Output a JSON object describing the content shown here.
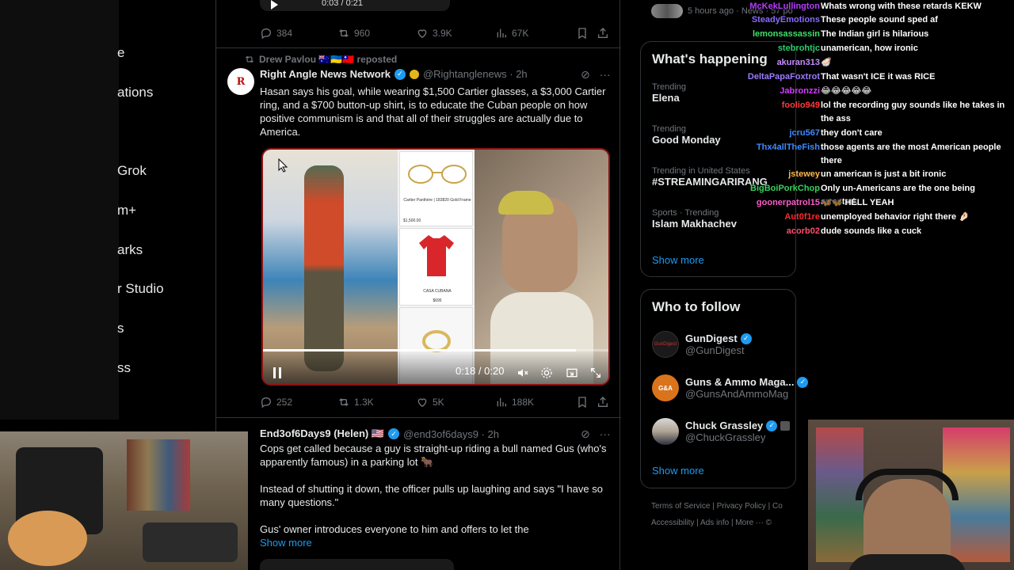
{
  "left_nav": {
    "items": [
      {
        "label": "e"
      },
      {
        "label": "ations"
      },
      {
        "label": "Grok"
      },
      {
        "label": "m+"
      },
      {
        "label": "arks"
      },
      {
        "label": "r Studio"
      },
      {
        "label": "s"
      },
      {
        "label": "ss"
      }
    ]
  },
  "top_tweet": {
    "video_time": "0:03 / 0:21",
    "replies": "384",
    "reposts": "960",
    "likes": "3.9K",
    "views": "67K"
  },
  "tweet1": {
    "repost_by": "Drew Pavlou 🇦🇺🇺🇦🇹🇼 reposted",
    "avatar_text": "R",
    "author": "Right Angle News Network",
    "handle": "@Rightanglenews · 2h",
    "text": "Hasan says his goal, while wearing $1,500 Cartier glasses, a $3,000 Cartier ring, and a $700 button-up shirt, is to educate the Cuban people on how positive communism is and that all of their struggles are actually due to America.",
    "video_time": "0:18 / 0:20",
    "media_labels": [
      "Cartier Panthère | 183820 Gold Frame",
      "$1,500.00",
      "CASA CUBANA",
      "$695"
    ],
    "replies": "252",
    "reposts": "1.3K",
    "likes": "5K",
    "views": "188K"
  },
  "tweet2": {
    "author": "End3of6Days9 (Helen) 🇺🇸",
    "handle": "@end3of6days9 · 2h",
    "text1": "Cops get called because a guy is straight-up riding a bull named Gus (who's apparently famous) in a parking lot 🐂",
    "text2": "Instead of shutting it down, the officer pulls up laughing and says \"I have so many questions.\"",
    "text3": "Gus' owner introduces everyone to him and offers to let the",
    "show_more": "Show more"
  },
  "sidebar": {
    "news_meta": "5 hours ago · News · 57 po",
    "happening_title": "What's happening",
    "trends": [
      {
        "category": "Trending",
        "name": "Elena"
      },
      {
        "category": "Trending",
        "name": "Good Monday"
      },
      {
        "category": "Trending in United States",
        "name": "#STREAMINGARIRANG"
      },
      {
        "category": "Sports · Trending",
        "name": "Islam Makhachev"
      }
    ],
    "show_more": "Show more",
    "follow_title": "Who to follow",
    "follow": [
      {
        "name": "GunDigest",
        "handle": "@GunDigest",
        "avatar_text": "GunDigest"
      },
      {
        "name": "Guns & Ammo Maga...",
        "handle": "@GunsAndAmmoMag",
        "avatar_text": "G&A"
      },
      {
        "name": "Chuck Grassley",
        "handle": "@ChuckGrassley",
        "avatar_text": ""
      }
    ],
    "show_more_2": "Show more",
    "footer_1": "Terms of Service  |  Privacy Policy  |  Co",
    "footer_2": "Accessibility  |  Ads info  |  More ···  ©"
  },
  "chat": [
    {
      "user": "McKekLullington",
      "msg": "Whats wrong with these retards KEKW",
      "color": "#b53cff"
    },
    {
      "user": "SteadyEmotions",
      "msg": "These people sound sped af",
      "color": "#8a6bff"
    },
    {
      "user": "lemonsassassin",
      "msg": "The Indian girl is hilarious",
      "color": "#3fe06a"
    },
    {
      "user": "stebrohtjc",
      "msg": "unamerican, how ironic",
      "color": "#2ecc71"
    },
    {
      "user": "akuran313",
      "msg": "🦪",
      "color": "#c78cff"
    },
    {
      "user": "DeltaPapaFoxtrot",
      "msg": "That wasn't ICE it was RICE",
      "color": "#9b7bff"
    },
    {
      "user": "Jabronzzi",
      "msg": "😂😂😂😂😂",
      "color": "#d63cff"
    },
    {
      "user": "foolio949",
      "msg": "lol the recording guy sounds like he takes in the ass",
      "color": "#ff3b3b"
    },
    {
      "user": "jcru567",
      "msg": "they don't care",
      "color": "#3d8bff"
    },
    {
      "user": "Thx4allTheFish",
      "msg": "those agents are the most American people there",
      "color": "#3d8bff"
    },
    {
      "user": "jstewey",
      "msg": "un american is just a bit ironic",
      "color": "#ffb84d"
    },
    {
      "user": "BigBoiPorkChop",
      "msg": "Only un-Americans are the one being arrested.",
      "color": "#38d35e"
    },
    {
      "user": "goonerpatrol15",
      "msg": "🦋🦋 HELL YEAH",
      "color": "#ff5ac8"
    },
    {
      "user": "Aut0f1re",
      "msg": "unemployed behavior right there 🤌🏻",
      "color": "#ff2a2a"
    },
    {
      "user": "acorb02",
      "msg": "dude sounds like a cuck",
      "color": "#ff4d6d"
    }
  ],
  "colors": {
    "accent": "#1d9bf0",
    "muted": "#71767b",
    "border": "#2f3336",
    "media_border": "#8d1414"
  },
  "icons": {
    "reply": "reply-icon",
    "repost": "repost-icon",
    "like": "heart-icon",
    "views": "views-icon",
    "bookmark": "bookmark-icon",
    "share": "share-icon"
  }
}
